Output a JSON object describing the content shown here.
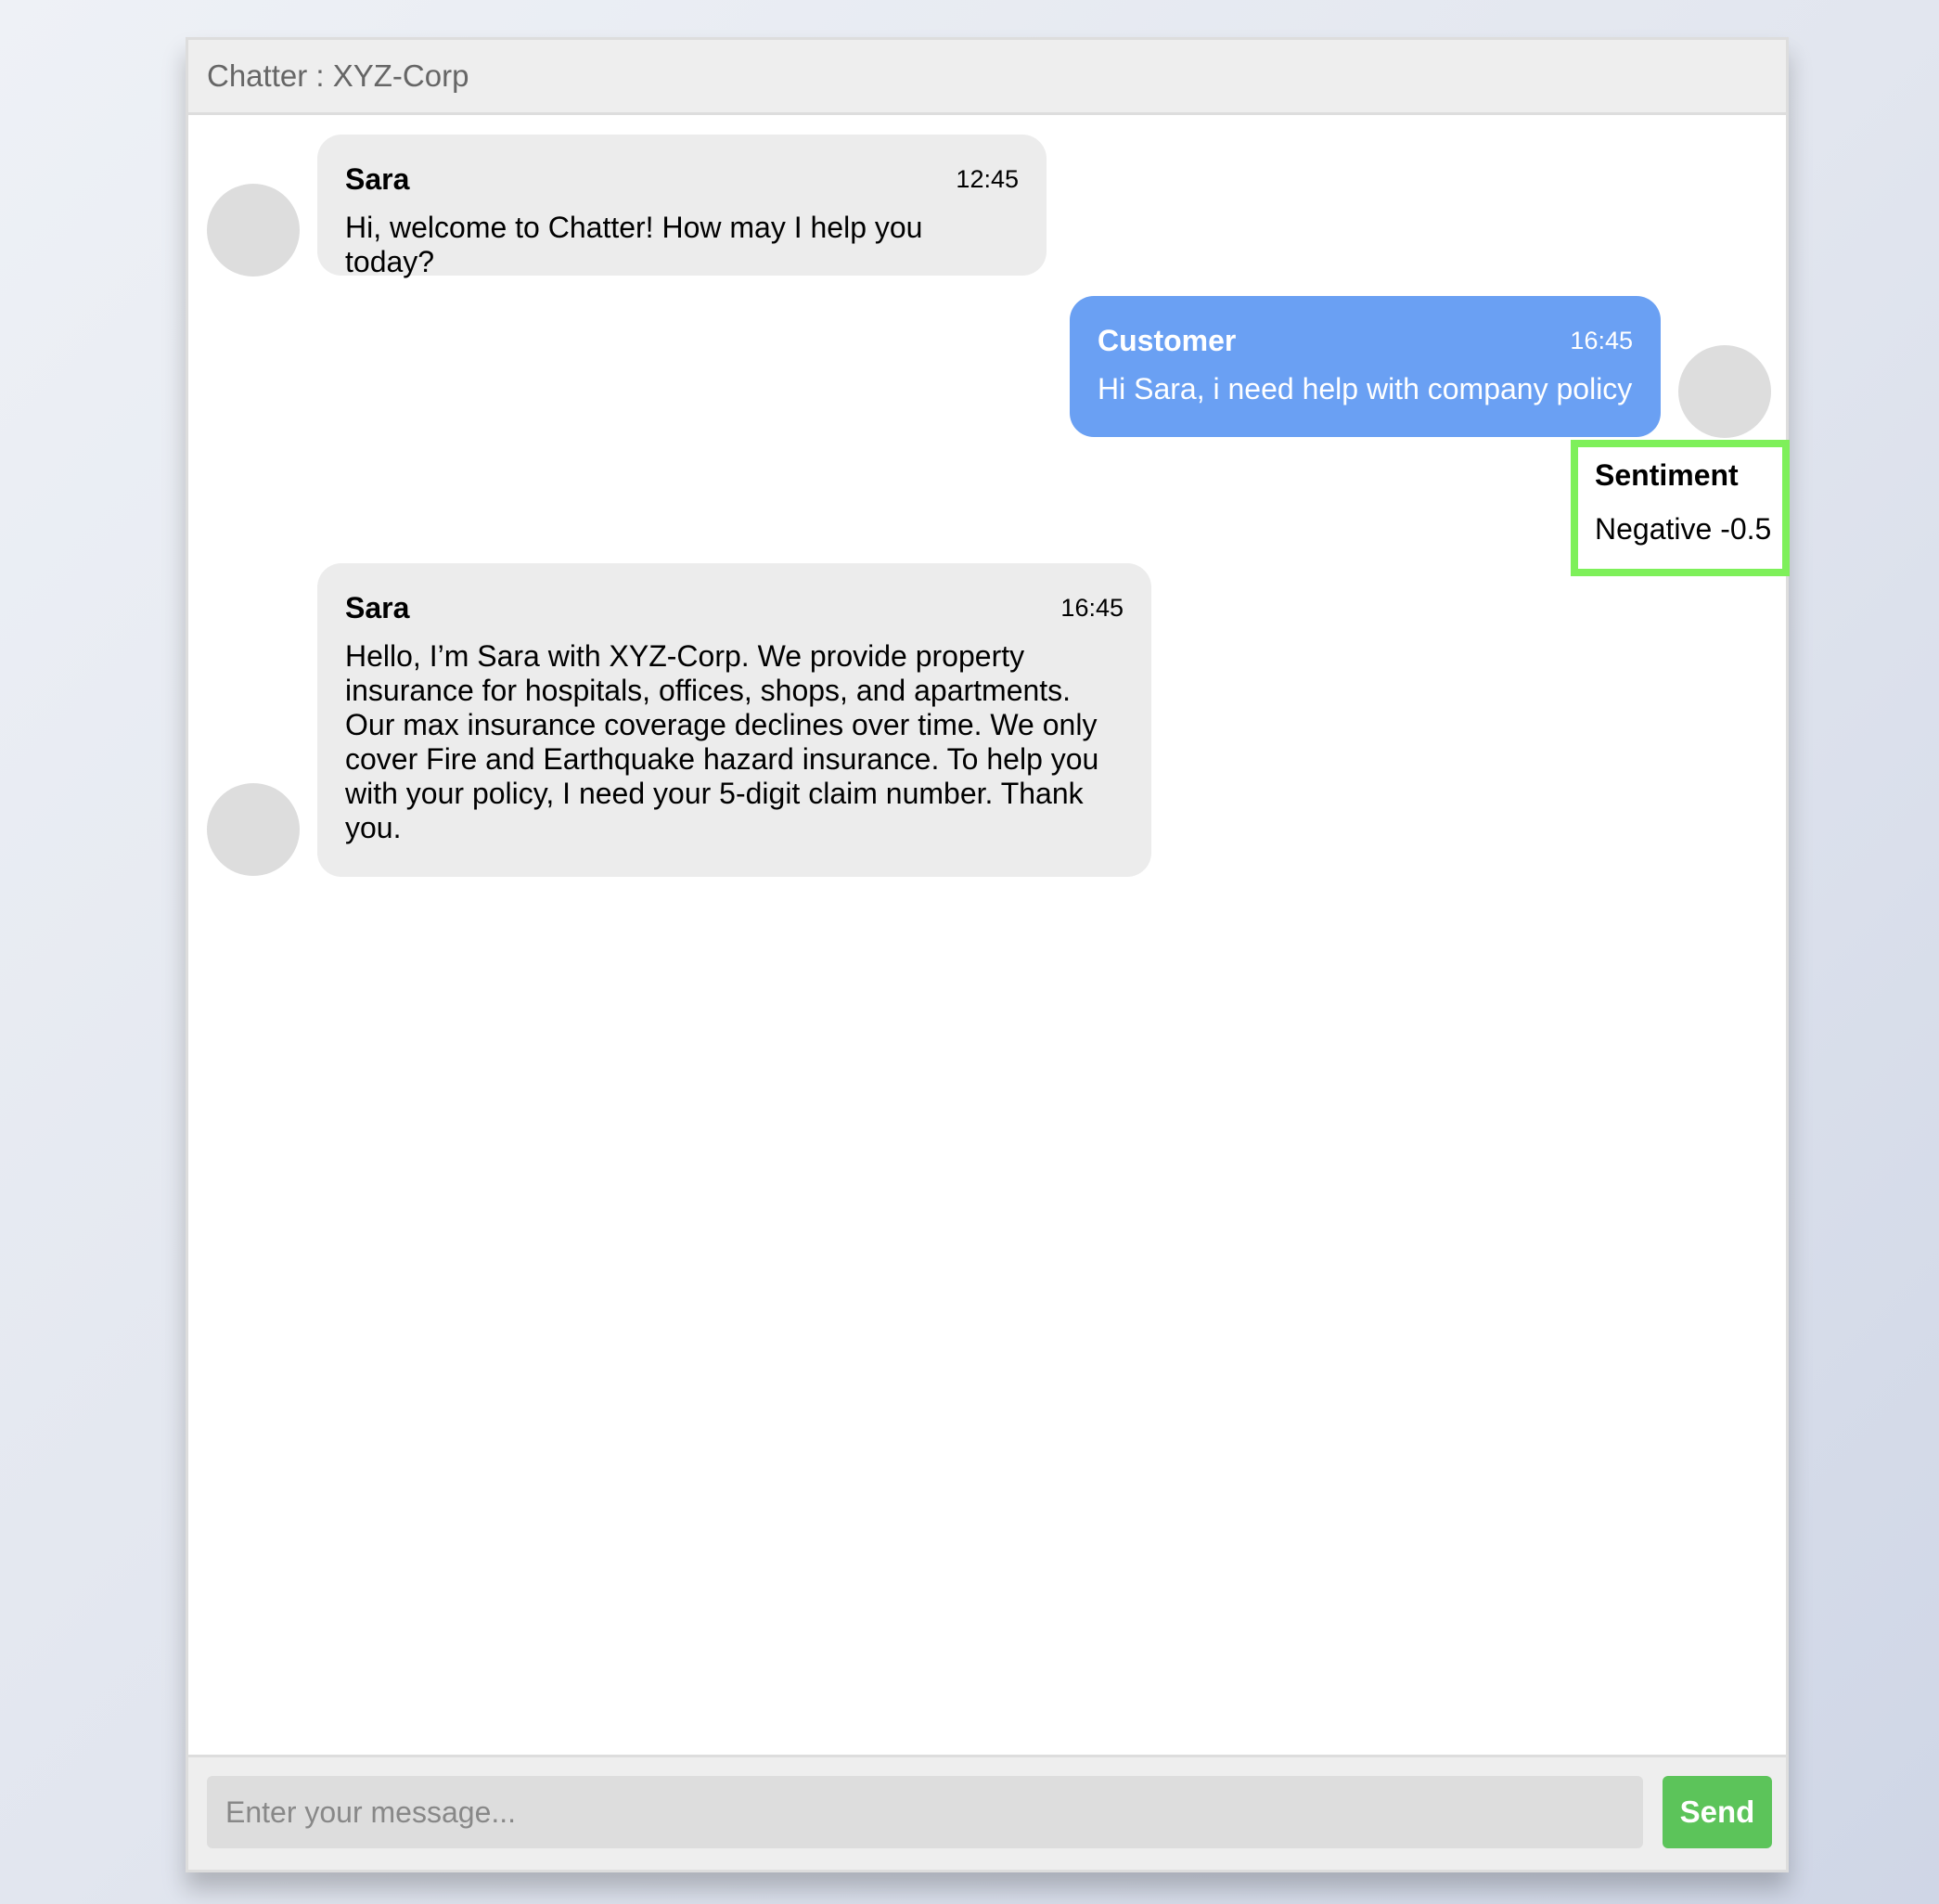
{
  "header": {
    "title": "Chatter : XYZ-Corp"
  },
  "messages": [
    {
      "sender": "Sara",
      "time": "12:45",
      "text": "Hi, welcome to Chatter! How may I help you today?",
      "side": "left"
    },
    {
      "sender": "Customer",
      "time": "16:45",
      "text": "Hi Sara, i need help with company policy",
      "side": "right"
    },
    {
      "sender": "Sara",
      "time": "16:45",
      "text": "Hello, I’m Sara with XYZ-Corp. We provide property insurance for hospitals, offices, shops, and apartments. Our max insurance coverage declines over time. We only cover Fire and Earthquake hazard insurance. To help you with your policy, I need your 5-digit claim number. Thank you.",
      "side": "left"
    }
  ],
  "sentiment": {
    "title": "Sentiment",
    "value": "Negative -0.5"
  },
  "composer": {
    "placeholder": "Enter your message...",
    "value": "",
    "send_label": "Send"
  },
  "colors": {
    "agent_bubble": "#ececec",
    "customer_bubble": "#6aa0f3",
    "send_button": "#5cc45a",
    "sentiment_border": "#7ef05a"
  }
}
